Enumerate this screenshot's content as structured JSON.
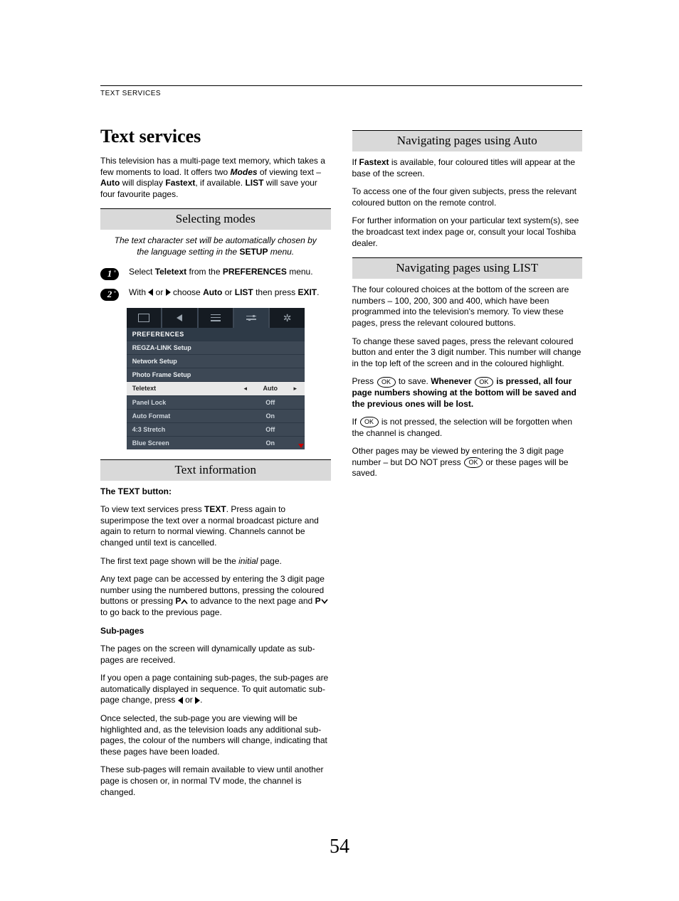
{
  "header": "TEXT SERVICES",
  "title": "Text services",
  "intro": {
    "p1a": "This television has a multi-page text memory, which takes a few moments to load. It offers two ",
    "modes": "Modes",
    "p1b": " of viewing text – ",
    "auto": "Auto",
    "p1c": " will display ",
    "fastext": "Fastext",
    "p1d": ", if available. ",
    "list": "LIST",
    "p1e": " will save your four favourite pages."
  },
  "selecting": {
    "title": "Selecting modes",
    "note_a": "The text character set will be automatically chosen by the language setting in the ",
    "note_b": "SETUP",
    "note_c": " menu.",
    "step1": {
      "a": "Select ",
      "b": "Teletext",
      "c": " from the ",
      "d": "PREFERENCES",
      "e": " menu."
    },
    "step2": {
      "a": "With ",
      "b": " or ",
      "c": " choose ",
      "d": "Auto",
      "e": " or ",
      "f": "LIST",
      "g": " then press ",
      "h": "EXIT",
      "i": "."
    }
  },
  "menu": {
    "title": "PREFERENCES",
    "rows": [
      {
        "label": "REGZA-LINK Setup",
        "value": "",
        "type": "sub"
      },
      {
        "label": "Network Setup",
        "value": "",
        "type": "sub"
      },
      {
        "label": "Photo Frame Setup",
        "value": "",
        "type": "sub"
      },
      {
        "label": "Teletext",
        "value": "Auto",
        "type": "hi"
      },
      {
        "label": "Panel Lock",
        "value": "Off",
        "type": "row"
      },
      {
        "label": "Auto Format",
        "value": "On",
        "type": "row"
      },
      {
        "label": "4:3 Stretch",
        "value": "Off",
        "type": "row"
      },
      {
        "label": "Blue Screen",
        "value": "On",
        "type": "row"
      }
    ]
  },
  "textinfo": {
    "title": "Text information",
    "h1": "The TEXT button:",
    "p1a": "To view text services press ",
    "p1b": "TEXT",
    "p1c": ". Press again to superimpose the text over a normal broadcast picture and again to return to normal viewing. Channels cannot be changed until text is cancelled.",
    "p2a": "The first text page shown will be the ",
    "p2b": "initial",
    "p2c": " page.",
    "p3a": "Any text page can be accessed by entering the 3 digit page number using the numbered buttons, pressing the coloured buttons or pressing ",
    "p3b": "P",
    "p3c": " to advance to the next page and ",
    "p3d": "P",
    "p3e": " to go back to the previous page.",
    "h2": "Sub-pages",
    "p4": "The pages on the screen will dynamically update as sub-pages are received.",
    "p5a": "If you open a page containing sub-pages, the sub-pages are automatically displayed in sequence. To quit automatic sub-page change, press ",
    "p5b": " or ",
    "p5c": ".",
    "p6": "Once selected, the sub-page you are viewing will be highlighted and, as the television loads any additional sub-pages, the colour of the numbers will change, indicating that these pages have been loaded.",
    "p7": "These sub-pages will remain available to view until another page is chosen or, in normal TV mode, the channel is changed."
  },
  "navauto": {
    "title": "Navigating pages using Auto",
    "p1a": "If ",
    "p1b": "Fastext",
    "p1c": " is available, four coloured titles will appear at the base of the screen.",
    "p2": "To access one of the four given subjects, press the relevant coloured button on the remote control.",
    "p3": "For further information on your particular text system(s), see the broadcast text index page or, consult your local Toshiba dealer."
  },
  "navlist": {
    "title": "Navigating pages using LIST",
    "p1": "The four coloured choices at the bottom of the screen are numbers – 100, 200, 300 and 400, which have been programmed into the television's memory. To view these pages, press the relevant coloured buttons.",
    "p2": "To change these saved pages, press the relevant coloured button and enter the 3 digit number. This number will change in the top left of the screen and in the coloured highlight.",
    "p3a": "Press ",
    "p3b": " to save. ",
    "p3c": "Whenever ",
    "p3d": " is pressed, all four page numbers showing at the bottom will be saved and the previous ones will be lost.",
    "p4a": "If ",
    "p4b": " is not pressed, the selection will be forgotten when the channel is changed.",
    "p5a": "Other pages may be viewed by entering the 3 digit page number – but DO NOT press ",
    "p5b": " or these pages will be saved."
  },
  "ok": "OK",
  "pagenum": "54"
}
